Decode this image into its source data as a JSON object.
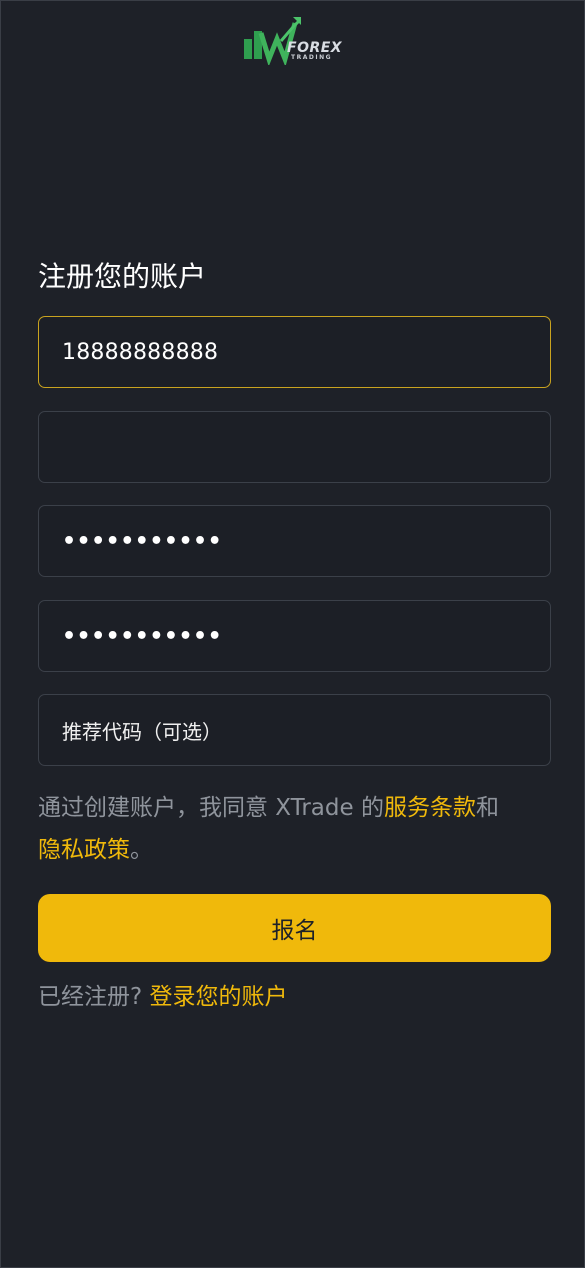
{
  "logo": {
    "brand": "FOREX",
    "sub": "TRADING",
    "colors": {
      "green": "#2f9e4f",
      "arrow": "#4cc36a"
    }
  },
  "form": {
    "title": "注册您的账户",
    "phone_value": "18888888888",
    "code_value": "",
    "password_mask": "•••••••••••",
    "confirm_password_mask": "•••••••••••",
    "referral_placeholder": "推荐代码（可选）"
  },
  "terms": {
    "prefix": "通过创建账户，我同意 XTrade 的",
    "terms_link": "服务条款",
    "and": "和",
    "privacy_link": "隐私政策",
    "suffix": "。"
  },
  "submit_label": "报名",
  "login": {
    "prompt": "已经注册?",
    "link": "登录您的账户"
  },
  "colors": {
    "background": "#1e2128",
    "accent": "#f0b90b",
    "muted_text": "#8f949c",
    "field_border": "#3b4049",
    "focus_border": "#c9a31f"
  }
}
